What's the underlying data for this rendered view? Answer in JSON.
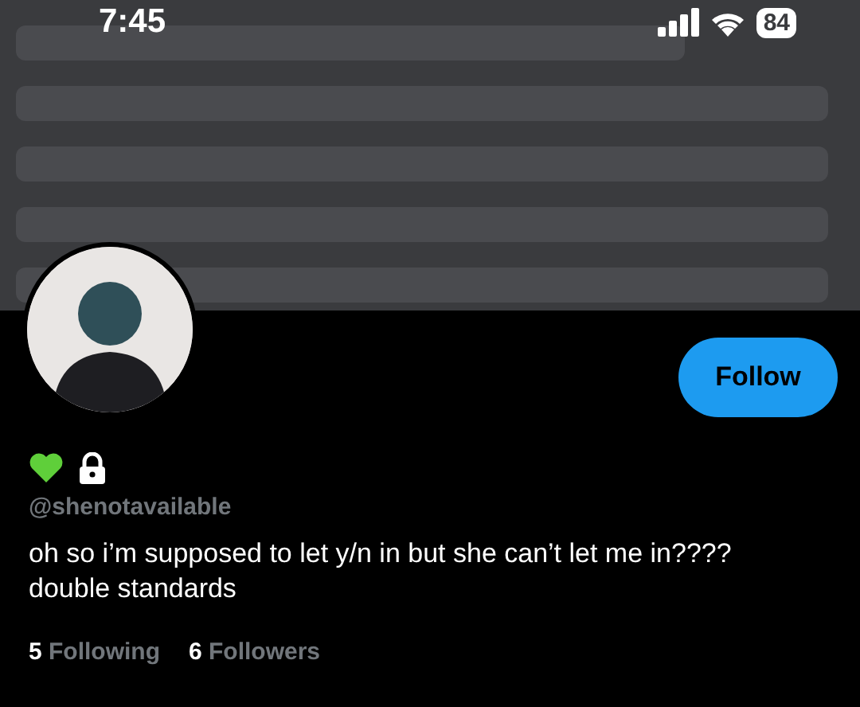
{
  "status_bar": {
    "time": "7:45",
    "battery": "84"
  },
  "follow_button": {
    "label": "Follow"
  },
  "handle": "@shenotavailable",
  "bio": "oh so i’m supposed to let y/n in but she can’t let me in???? double standards",
  "stats": [
    {
      "count": "5",
      "label": "Following"
    },
    {
      "count": "6",
      "label": "Followers"
    }
  ]
}
